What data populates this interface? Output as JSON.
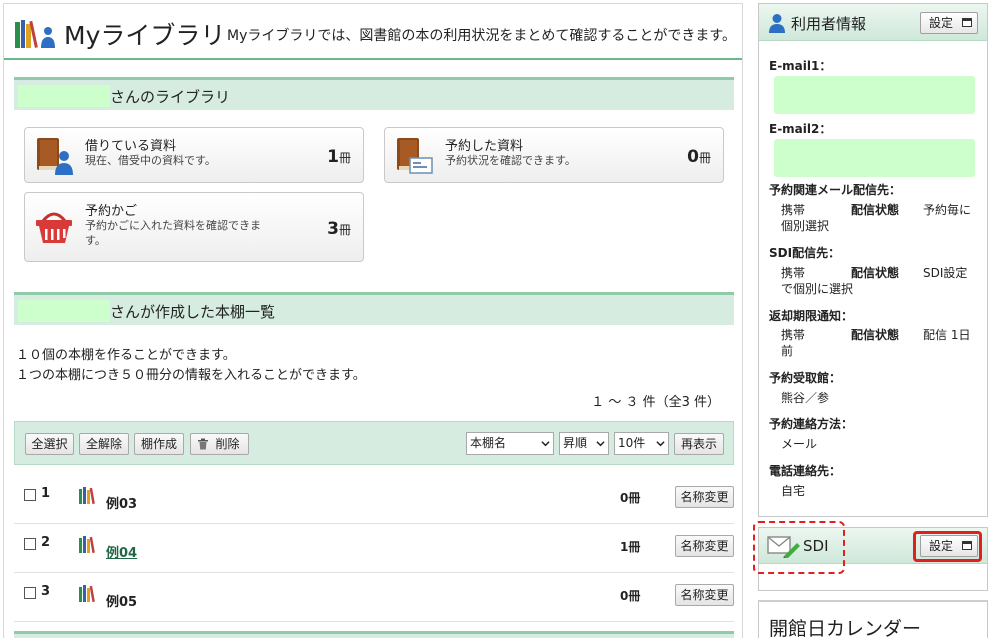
{
  "header": {
    "title": "Myライブラリ",
    "description": "Myライブラリでは、図書館の本の利用状況をまとめて確認することができます。"
  },
  "library_section": {
    "title": "さんのライブラリ"
  },
  "cards": [
    {
      "title": "借りている資料",
      "subtitle": "現在、借受中の資料です。",
      "count": "1",
      "unit": "冊"
    },
    {
      "title": "予約した資料",
      "subtitle": "予約状況を確認できます。",
      "count": "0",
      "unit": "冊"
    },
    {
      "title": "予約かご",
      "subtitle": "予約かごに入れた資料を確認できます。",
      "count": "3",
      "unit": "冊"
    }
  ],
  "shelves_section": {
    "title": "さんが作成した本棚一覧",
    "info_line1": "１０個の本棚を作ることができます。",
    "info_line2": "１つの本棚につき５０冊分の情報を入れることができます。",
    "range": "１ ～ ３ 件（全3 件）"
  },
  "toolbar": {
    "select_all": "全選択",
    "deselect_all": "全解除",
    "create_shelf": "棚作成",
    "delete": "削除",
    "sort_field": "本棚名",
    "sort_order": "昇順",
    "per_page": "10件",
    "redisplay": "再表示"
  },
  "shelves": [
    {
      "num": "1",
      "name": "例03",
      "count": "0冊",
      "rename": "名称変更",
      "linked": false
    },
    {
      "num": "2",
      "name": "例04",
      "count": "1冊",
      "rename": "名称変更",
      "linked": true
    },
    {
      "num": "3",
      "name": "例05",
      "count": "0冊",
      "rename": "名称変更",
      "linked": false
    }
  ],
  "user_panel": {
    "title": "利用者情報",
    "settings": "設定",
    "email1_label": "E-mail1：",
    "email2_label": "E-mail2：",
    "reserve_mail_label": "予約関連メール配信先：",
    "reserve_mail_device": "携帯",
    "reserve_mail_status_label": "配信状態",
    "reserve_mail_value": "予約毎に",
    "reserve_mail_value2": "個別選択",
    "sdi_label": "SDI配信先：",
    "sdi_device": "携帯",
    "sdi_status_label": "配信状態",
    "sdi_value": "SDI設定",
    "sdi_value2": "で個別に選択",
    "due_label": "返却期限通知：",
    "due_device": "携帯",
    "due_status_label": "配信状態",
    "due_value": "配信 1日",
    "due_value2": "前",
    "pickup_label": "予約受取館：",
    "pickup_value": "熊谷／参",
    "contact_method_label": "予約連絡方法：",
    "contact_method_value": "メール",
    "phone_label": "電話連絡先：",
    "phone_value": "自宅"
  },
  "sdi_panel": {
    "title": "SDI",
    "settings": "設定"
  },
  "calendar_panel": {
    "title": "開館日カレンダー"
  },
  "colors": {
    "section_bg": "#d6ece0",
    "section_border": "#8fcaa9",
    "masked_field": "#ccffcc",
    "highlight_red": "#e02020",
    "link_green": "#226644"
  }
}
